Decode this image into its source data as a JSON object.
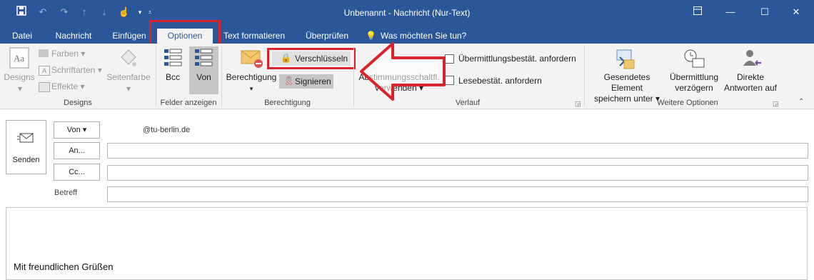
{
  "window": {
    "title": "Unbenannt - Nachricht (Nur-Text)"
  },
  "tabs": [
    {
      "label": "Datei"
    },
    {
      "label": "Nachricht"
    },
    {
      "label": "Einfügen"
    },
    {
      "label": "Optionen"
    },
    {
      "label": "Text formatieren"
    },
    {
      "label": "Überprüfen"
    },
    {
      "label": "Was möchten Sie tun?"
    }
  ],
  "ribbon": {
    "designs": {
      "designs_label": "Designs",
      "farben": "Farben",
      "schriftarten": "Schriftarten",
      "effekte": "Effekte",
      "seitenfarbe": "Seitenfarbe",
      "group_label": "Designs"
    },
    "felder": {
      "bcc": "Bcc",
      "von": "Von",
      "group_label": "Felder anzeigen"
    },
    "berechtigung": {
      "berechtigung": "Berechtigung",
      "verschluesseln": "Verschlüsseln",
      "signieren": "Signieren",
      "group_label": "Berechtigung"
    },
    "verlauf": {
      "abstimmung_line1": "Abstimmungsschaltfl.",
      "abstimmung_line2": "verwenden",
      "uebermittlung": "Übermittlungsbestät. anfordern",
      "lesebestaet": "Lesebestät. anfordern",
      "group_label": "Verlauf"
    },
    "weitere": {
      "gesendetes_line1": "Gesendetes Element",
      "gesendetes_line2": "speichern unter",
      "verzoegern_line1": "Übermittlung",
      "verzoegern_line2": "verzögern",
      "direkte_line1": "Direkte",
      "direkte_line2": "Antworten auf",
      "group_label": "Weitere Optionen"
    }
  },
  "compose": {
    "send_label": "Senden",
    "von_label": "Von",
    "from_address": "@tu-berlin.de",
    "an_label": "An...",
    "cc_label": "Cc...",
    "betreff_label": "Betreff",
    "body_text": "Mit freundlichen Grüßen"
  },
  "colors": {
    "accent": "#2b579a",
    "highlight": "#d9222a"
  },
  "icons": [
    "save-icon",
    "undo-icon",
    "redo-icon",
    "up-arrow-icon",
    "down-arrow-icon",
    "touch-mode-icon",
    "customize-icon",
    "lightbulb-icon",
    "lock-icon",
    "ribbon-icon",
    "envelope-icon"
  ]
}
